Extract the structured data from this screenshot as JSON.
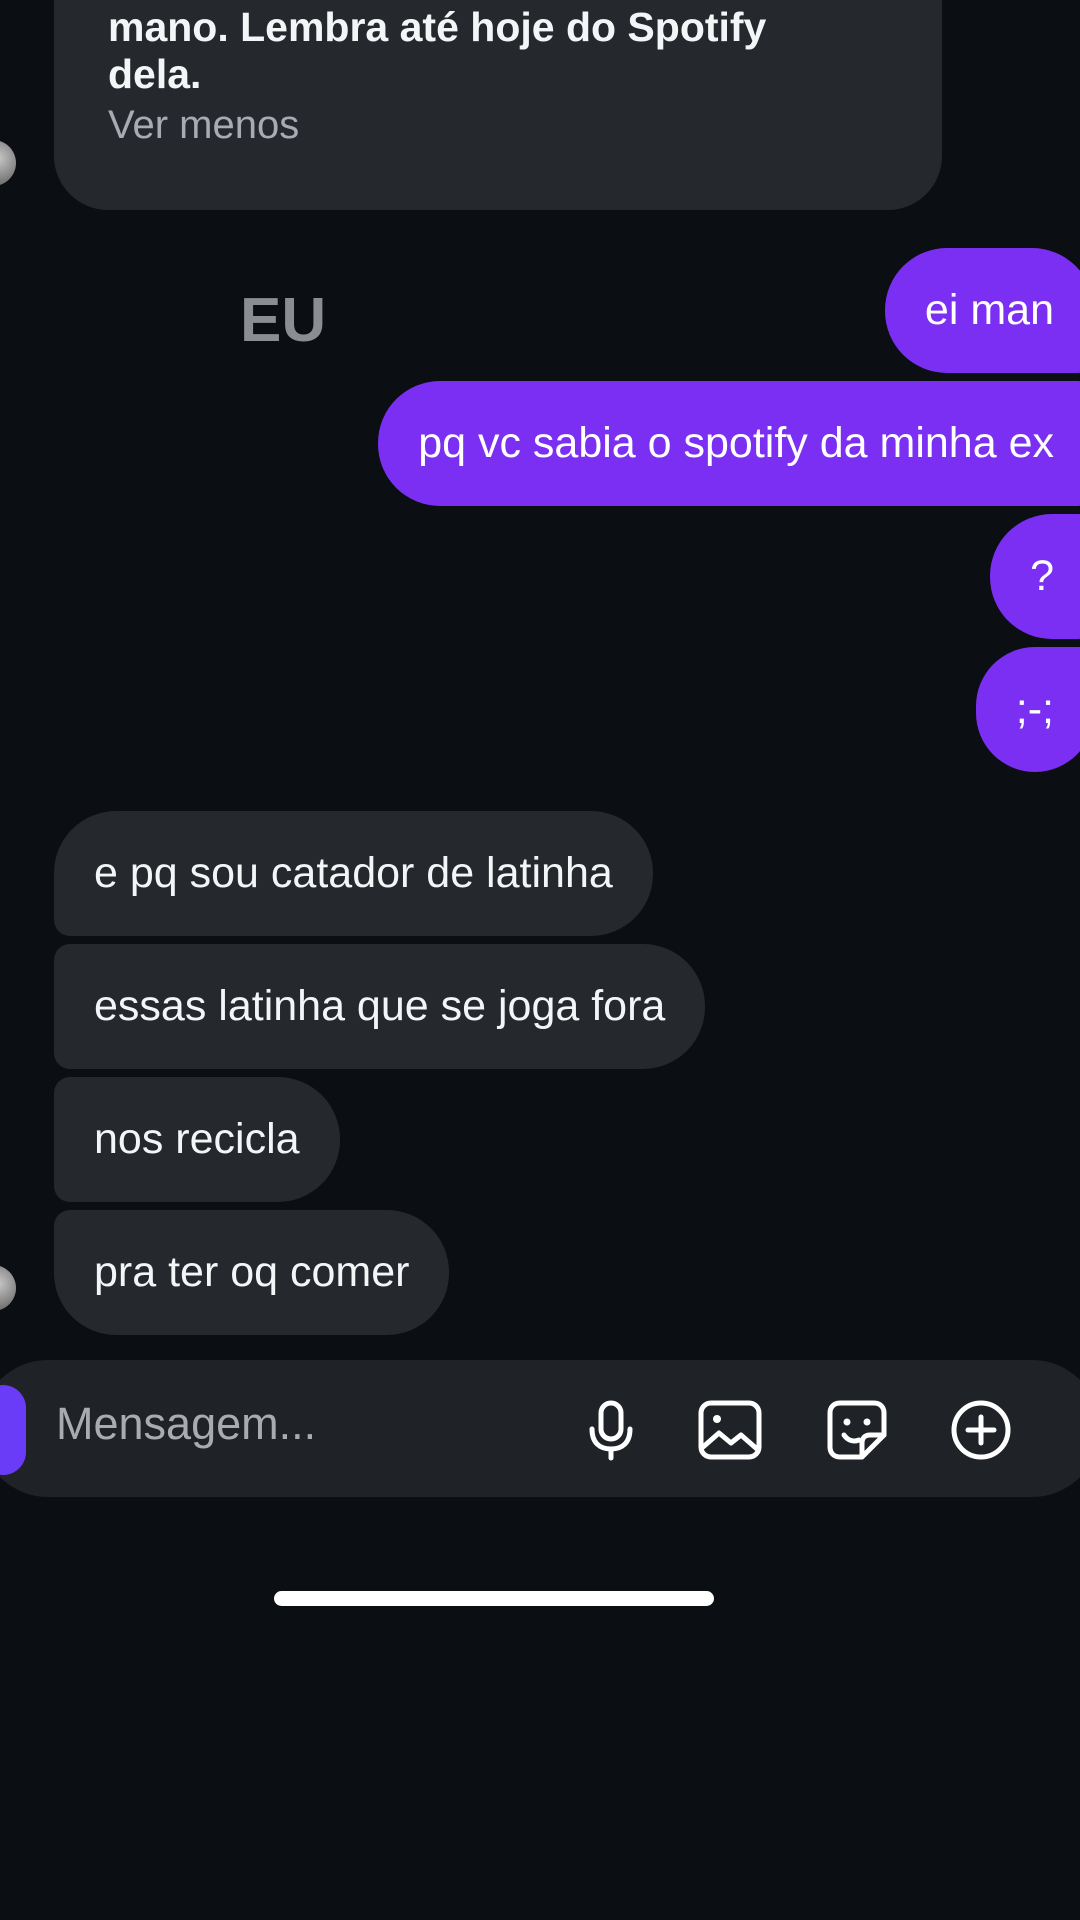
{
  "thread": {
    "long_message": {
      "line1": "mano. Lembra até hoje do Spotify",
      "line2": "dela.",
      "toggle": "Ver menos"
    },
    "overlay_label": "EU",
    "sent": [
      {
        "text": "ei man"
      },
      {
        "text": "pq vc sabia o spotify da minha ex"
      },
      {
        "text": "?"
      },
      {
        "text": ";-;"
      }
    ],
    "received": [
      {
        "text": "e pq sou catador de latinha"
      },
      {
        "text": "essas latinha que se joga fora"
      },
      {
        "text": "nos recicla"
      },
      {
        "text": "pra ter oq comer"
      }
    ]
  },
  "composer": {
    "placeholder": "Mensagem...",
    "icons": [
      "mic-icon",
      "gallery-icon",
      "sticker-icon",
      "add-icon"
    ]
  },
  "colors": {
    "background": "#0b0e12",
    "received_bubble": "#25282d",
    "sent_bubble": "#7b2ff3",
    "composer": "#1f2226"
  }
}
